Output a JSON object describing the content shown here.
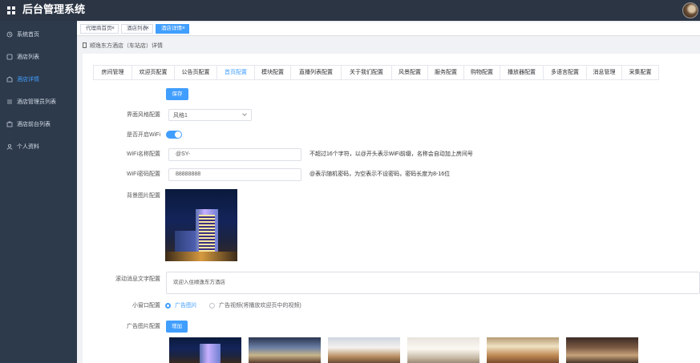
{
  "app": {
    "title": "后台管理系统"
  },
  "sidebar": {
    "items": [
      {
        "label": "系统首页",
        "icon": "home-icon"
      },
      {
        "label": "酒店列表",
        "icon": "list-icon"
      },
      {
        "label": "酒店详情",
        "icon": "detail-icon"
      },
      {
        "label": "酒店管理员列表",
        "icon": "admin-icon"
      },
      {
        "label": "酒店前台列表",
        "icon": "desk-icon"
      },
      {
        "label": "个人资料",
        "icon": "user-icon"
      }
    ],
    "active_index": 2
  },
  "page_tabs": [
    {
      "label": "代理商首页"
    },
    {
      "label": "酒店列表"
    },
    {
      "label": "酒店详情"
    }
  ],
  "breadcrumb": {
    "text": "顺逸东方酒店（车站店）详情"
  },
  "config_tabs": [
    "房间管理",
    "欢迎页配置",
    "公告页配置",
    "首页配置",
    "模块配置",
    "直播列表配置",
    "关于我们配置",
    "风景配置",
    "服务配置",
    "购物配置",
    "播放器配置",
    "多语言配置",
    "消息管理",
    "采集配置"
  ],
  "active_config_tab": 3,
  "form": {
    "save_label": "保存",
    "theme": {
      "label": "界面风格配置",
      "value": "风格1"
    },
    "wifi_toggle": {
      "label": "是否开启WiFi",
      "enabled": true
    },
    "wifi_name": {
      "label": "WiFi名称配置",
      "value": "@SY-",
      "hint": "不超过16个字符，以@开头表示WiFi前缀，名称会自动加上房间号"
    },
    "wifi_password": {
      "label": "WiFi密码配置",
      "value": "88888888",
      "hint": "@表示随机密码，为空表示不设密码，密码长度为8-16位"
    },
    "background": {
      "label": "背景图片配置"
    },
    "marquee": {
      "label": "滚动消息文字配置",
      "value": "欢迎入住顺逸东方酒店"
    },
    "small_window": {
      "label": "小窗口配置",
      "options": [
        "广告图片",
        "广告视频(将播放欢迎页中的视频)"
      ],
      "selected": 0
    },
    "ad_images": {
      "label": "广告图片配置",
      "add_label": "增加"
    }
  },
  "colors": {
    "primary": "#409eff",
    "header_bg": "#2b3544",
    "sidebar_bg": "#2d3a4b"
  }
}
